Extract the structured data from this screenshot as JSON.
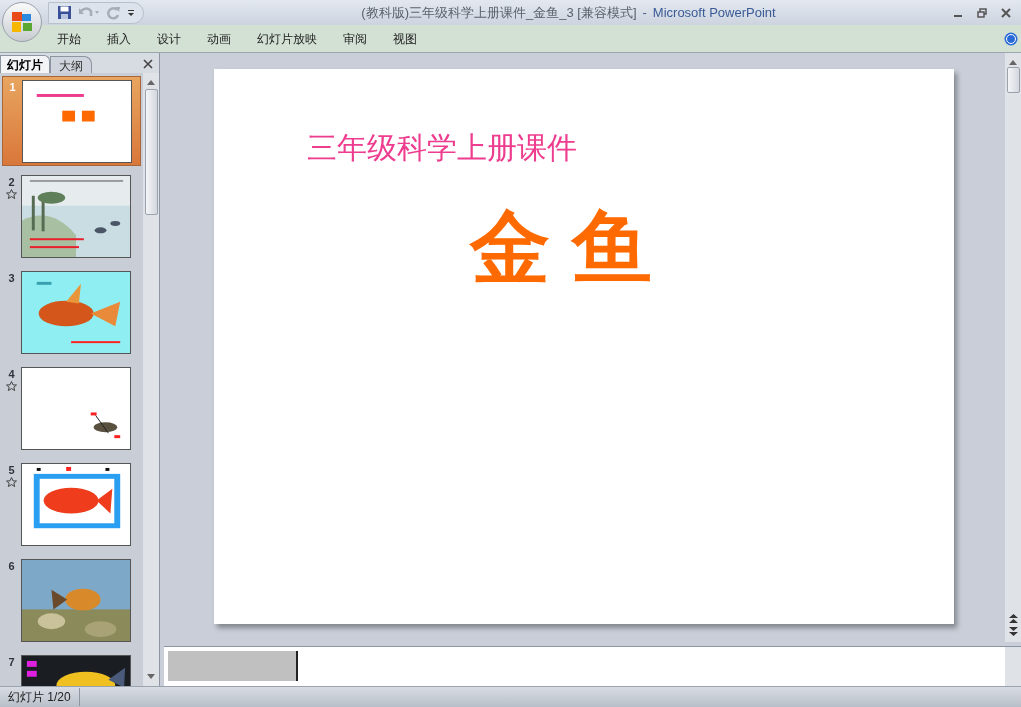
{
  "window": {
    "title": "(教科版)三年级科学上册课件_金鱼_3 [兼容模式]",
    "separator": "-",
    "app_name": "Microsoft PowerPoint"
  },
  "ribbon_tabs": [
    {
      "label": "开始",
      "selected": false
    },
    {
      "label": "插入",
      "selected": false
    },
    {
      "label": "设计",
      "selected": false
    },
    {
      "label": "动画",
      "selected": false
    },
    {
      "label": "幻灯片放映",
      "selected": false
    },
    {
      "label": "审阅",
      "selected": false
    },
    {
      "label": "视图",
      "selected": false
    }
  ],
  "panel_tabs": [
    {
      "label": "幻灯片",
      "selected": true
    },
    {
      "label": "大纲",
      "selected": false
    }
  ],
  "slides": [
    {
      "number": "1",
      "selected": true,
      "animated": false,
      "kind": "title"
    },
    {
      "number": "2",
      "selected": false,
      "animated": true,
      "kind": "scene"
    },
    {
      "number": "3",
      "selected": false,
      "animated": false,
      "kind": "fish"
    },
    {
      "number": "4",
      "selected": false,
      "animated": true,
      "kind": "small-fish"
    },
    {
      "number": "5",
      "selected": false,
      "animated": true,
      "kind": "diagram"
    },
    {
      "number": "6",
      "selected": false,
      "animated": false
    },
    {
      "number": "7",
      "selected": false,
      "animated": false,
      "kind": "dark"
    }
  ],
  "slide": {
    "subtitle": "三年级科学上册课件",
    "title": "金 鱼"
  },
  "status_bar": {
    "slide_counter": "幻灯片 1/20"
  }
}
